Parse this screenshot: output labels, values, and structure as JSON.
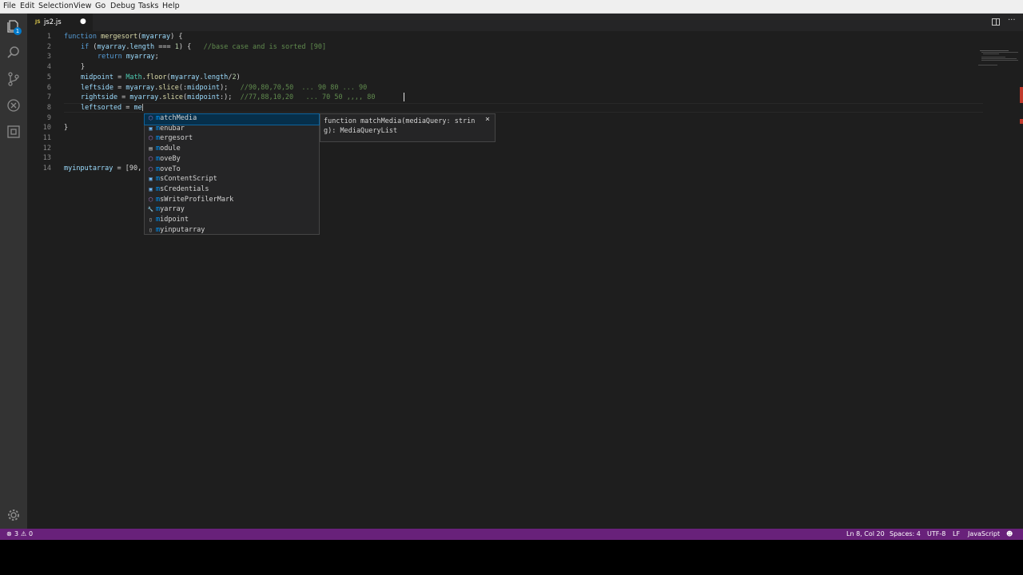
{
  "menu": [
    "File",
    "Edit",
    "Selection",
    "View",
    "Go",
    "Debug",
    "Tasks",
    "Help"
  ],
  "activity_badge": "1",
  "tab": {
    "icon": "JS",
    "name": "js2.js",
    "dirty_marker": "●"
  },
  "lines": [
    {
      "n": "1"
    },
    {
      "n": "2"
    },
    {
      "n": "3"
    },
    {
      "n": "4"
    },
    {
      "n": "5"
    },
    {
      "n": "6"
    },
    {
      "n": "7"
    },
    {
      "n": "8"
    },
    {
      "n": "9"
    },
    {
      "n": "10"
    },
    {
      "n": "11"
    },
    {
      "n": "12"
    },
    {
      "n": "13"
    },
    {
      "n": "14"
    }
  ],
  "code": {
    "l1": [
      "function",
      " mergesort",
      "(",
      "myarray",
      ") {"
    ],
    "l2": [
      "if",
      " (",
      "myarray",
      ".",
      "length",
      " === ",
      "1",
      ") {   ",
      "//base case and is sorted [90]"
    ],
    "l3": [
      "return",
      " ",
      "myarray",
      ";"
    ],
    "l4": "}",
    "l5": [
      "midpoint",
      " = ",
      "Math",
      ".",
      "floor",
      "(",
      "myarray",
      ".",
      "length",
      "/",
      "2",
      ")"
    ],
    "l6": [
      "leftside",
      " = ",
      "myarray",
      ".",
      "slice",
      "(:",
      "midpoint",
      ");   ",
      "//90,80,70,50  ... 90 80 ... 90"
    ],
    "l7": [
      "rightside",
      " = ",
      "myarray",
      ".",
      "slice",
      "(",
      "midpoint",
      ":);  ",
      "//77,88,10,20   ... 70 50 ,,,, 80"
    ],
    "l8": [
      "leftsorted",
      " = ",
      "me"
    ],
    "l10": "}",
    "l14": [
      "myinputarray",
      " = [90,"
    ]
  },
  "suggestions": [
    {
      "icon": "⬡",
      "hl": "m",
      "rest": "atchMedia"
    },
    {
      "icon": "▣",
      "hl": "m",
      "rest": "enubar"
    },
    {
      "icon": "⬡",
      "hl": "m",
      "rest": "ergesort"
    },
    {
      "icon": "▤",
      "hl": "m",
      "rest": "odule"
    },
    {
      "icon": "⬡",
      "hl": "m",
      "rest": "oveBy"
    },
    {
      "icon": "⬡",
      "hl": "m",
      "rest": "oveTo"
    },
    {
      "icon": "▣",
      "hl": "m",
      "rest": "sContentScript"
    },
    {
      "icon": "▣",
      "hl": "m",
      "rest": "sCredentials"
    },
    {
      "icon": "⬡",
      "hl": "m",
      "rest": "sWriteProfilerMark"
    },
    {
      "icon": "🔧",
      "hl": "m",
      "rest": "yarray"
    },
    {
      "icon": "▯",
      "hl": "m",
      "rest": "idpoint"
    },
    {
      "icon": "▯",
      "hl": "m",
      "rest": "yinputarray"
    }
  ],
  "detail": {
    "line1": "function matchMedia(mediaQuery: strin",
    "line2": "g): MediaQueryList",
    "close": "×"
  },
  "status": {
    "errors": "3",
    "warnings": "0",
    "position": "Ln 8, Col 20",
    "spaces": "Spaces: 4",
    "encoding": "UTF-8",
    "eol": "LF",
    "language": "JavaScript"
  },
  "colors": {
    "statusbar": "#68217a",
    "editor_bg": "#1e1e1e",
    "activity_bg": "#333333"
  }
}
